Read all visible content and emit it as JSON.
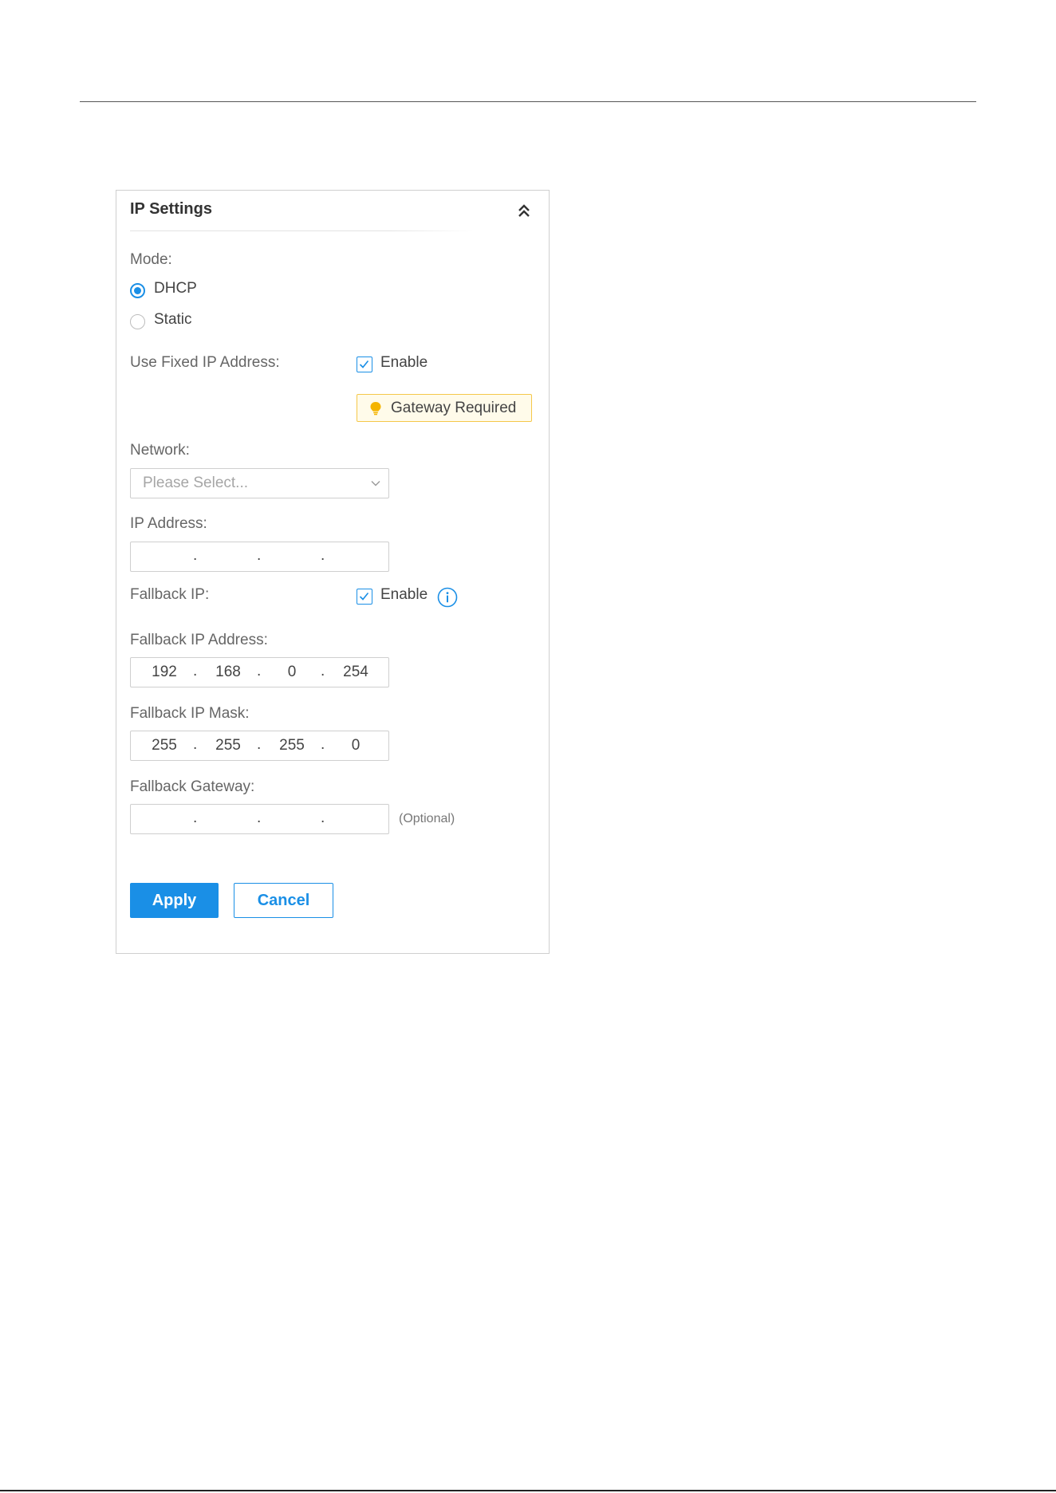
{
  "panel": {
    "title": "IP Settings",
    "mode": {
      "label": "Mode:",
      "options": [
        "DHCP",
        "Static"
      ],
      "selected": "DHCP"
    },
    "use_fixed_ip": {
      "label": "Use Fixed IP Address:",
      "checkbox_label": "Enable",
      "checked": true,
      "notice": "Gateway Required"
    },
    "network": {
      "label": "Network:",
      "placeholder": "Please Select..."
    },
    "ip_address": {
      "label": "IP Address:",
      "octets": [
        "",
        "",
        "",
        ""
      ]
    },
    "fallback_ip": {
      "label": "Fallback IP:",
      "checkbox_label": "Enable",
      "checked": true
    },
    "fallback_ip_address": {
      "label": "Fallback IP Address:",
      "octets": [
        "192",
        "168",
        "0",
        "254"
      ]
    },
    "fallback_ip_mask": {
      "label": "Fallback IP Mask:",
      "octets": [
        "255",
        "255",
        "255",
        "0"
      ]
    },
    "fallback_gateway": {
      "label": "Fallback Gateway:",
      "octets": [
        "",
        "",
        "",
        ""
      ],
      "hint": "(Optional)"
    },
    "buttons": {
      "apply": "Apply",
      "cancel": "Cancel"
    }
  },
  "colors": {
    "accent": "#1a8fe6",
    "notice_border": "#f5c84a",
    "notice_bulb": "#f4b400"
  },
  "icons": {
    "collapse": "double-chevron-up-icon",
    "notice": "lightbulb-icon",
    "select": "chevron-down-icon",
    "info": "info-icon",
    "checkbox": "checkmark-icon"
  }
}
